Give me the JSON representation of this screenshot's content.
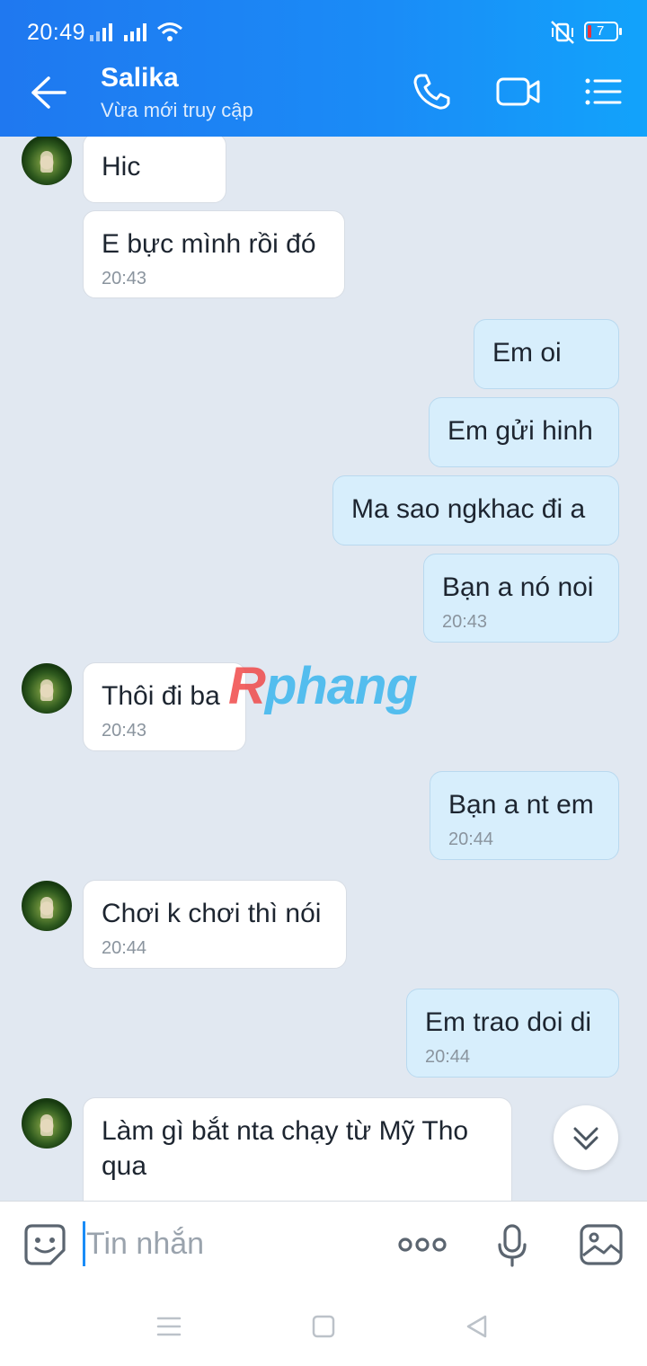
{
  "status_bar": {
    "time": "20:49",
    "battery": "7"
  },
  "header": {
    "contact_name": "Salika",
    "contact_status": "Vừa mới truy cập"
  },
  "messages": [
    {
      "dir": "in",
      "text": "Hic",
      "time": ""
    },
    {
      "dir": "in",
      "text": "E bực mình rồi đó",
      "time": "20:43"
    },
    {
      "dir": "out",
      "text": "Em oi",
      "time": ""
    },
    {
      "dir": "out",
      "text": "Em gửi hinh",
      "time": ""
    },
    {
      "dir": "out",
      "text": "Ma sao ngkhac đi a",
      "time": ""
    },
    {
      "dir": "out",
      "text": "Bạn a nó noi",
      "time": "20:43"
    },
    {
      "dir": "in",
      "text": "Thôi đi ba",
      "time": "20:43"
    },
    {
      "dir": "out",
      "text": "Bạn a nt em",
      "time": "20:44"
    },
    {
      "dir": "in",
      "text": "Chơi k chơi thì nói",
      "time": "20:44"
    },
    {
      "dir": "out",
      "text": "Em trao doi di",
      "time": "20:44"
    },
    {
      "dir": "in",
      "text": "Làm gì bắt nta chạy từ Mỹ Tho qua",
      "time": ""
    }
  ],
  "watermark": {
    "first": "R",
    "rest": "phang"
  },
  "input": {
    "placeholder": "Tin nhắn"
  },
  "icons": {
    "back": "back-arrow-icon",
    "call": "phone-icon",
    "video": "video-camera-icon",
    "menu": "list-menu-icon",
    "emoji": "sticker-icon",
    "more": "more-dots-icon",
    "mic": "microphone-icon",
    "gallery": "image-icon",
    "scroll": "chevron-double-down-icon"
  },
  "colors": {
    "header": "#1a8cf7",
    "incoming": "#ffffff",
    "outgoing": "#d7eefc",
    "background": "#e1e8f1"
  }
}
